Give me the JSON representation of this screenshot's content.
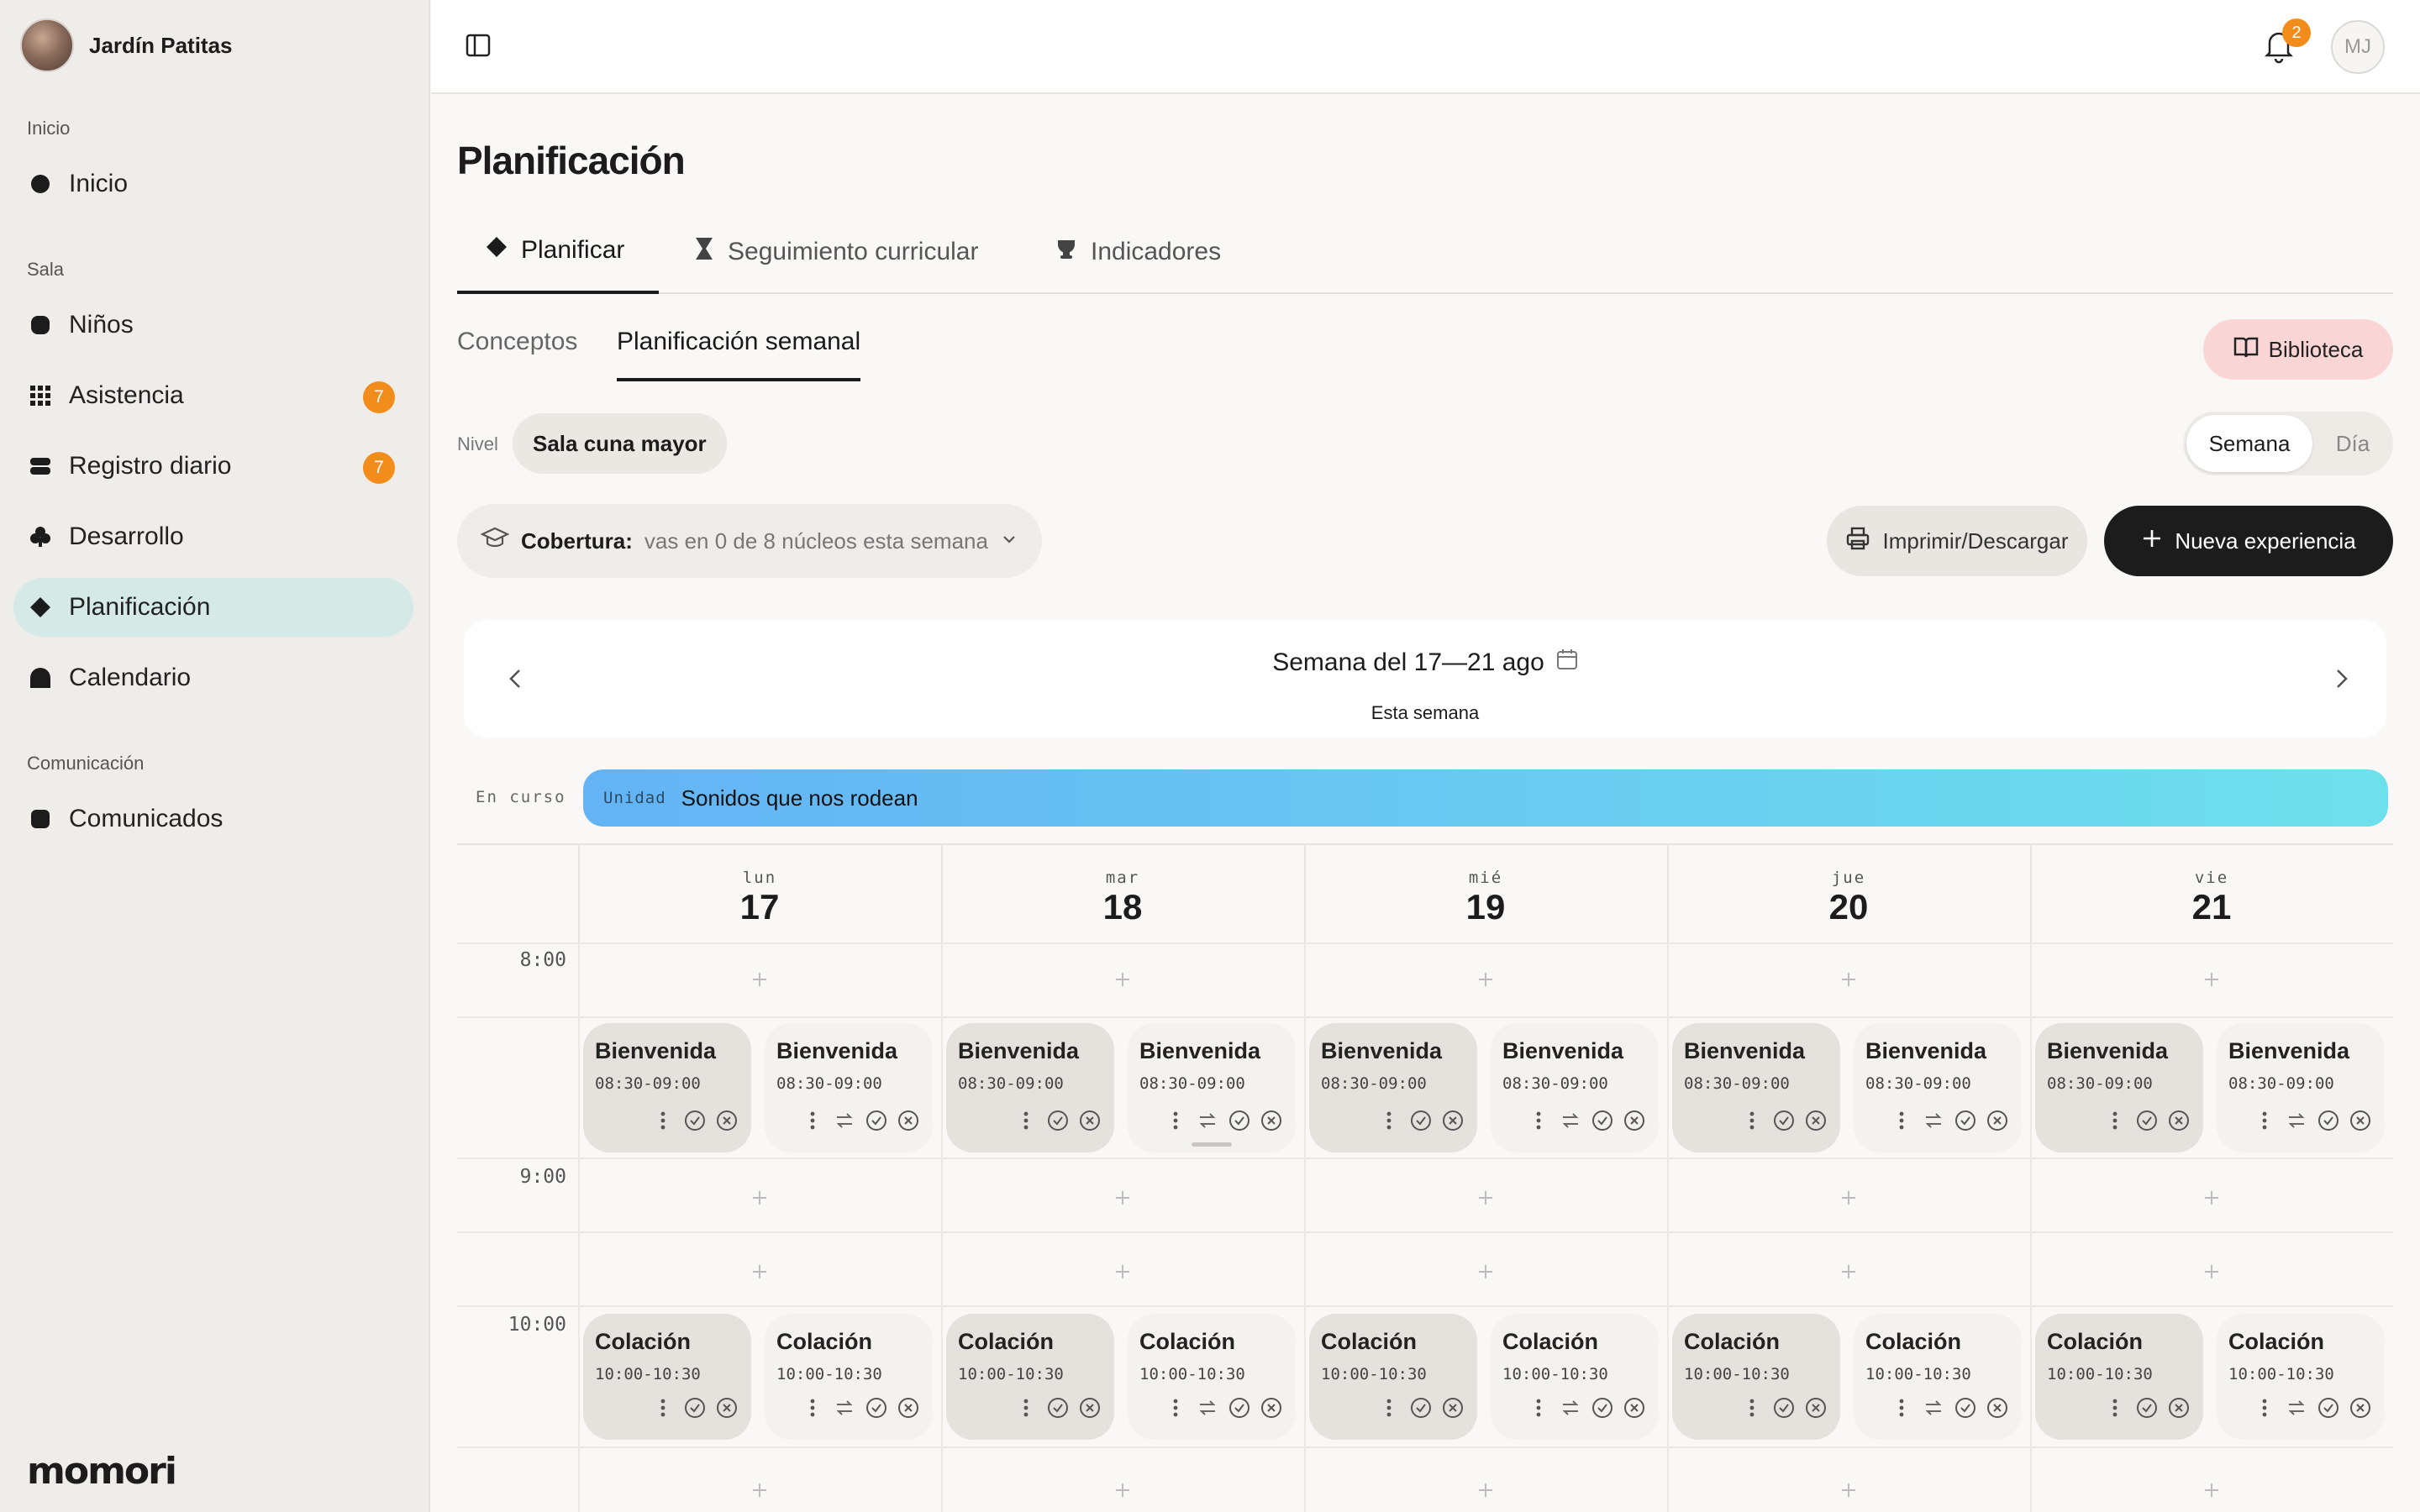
{
  "sidebar": {
    "org_name": "Jardín Patitas",
    "sections": {
      "inicio": "Inicio",
      "sala": "Sala",
      "comunicacion": "Comunicación"
    },
    "items": [
      {
        "label": "Inicio"
      },
      {
        "label": "Niños"
      },
      {
        "label": "Asistencia",
        "badge": "7"
      },
      {
        "label": "Registro diario",
        "badge": "7"
      },
      {
        "label": "Desarrollo"
      },
      {
        "label": "Planificación"
      },
      {
        "label": "Calendario"
      },
      {
        "label": "Comunicados"
      }
    ],
    "brand": "momori"
  },
  "topbar": {
    "notifications": "2",
    "user_initials": "MJ"
  },
  "page": {
    "title": "Planificación"
  },
  "tabs": [
    {
      "label": "Planificar"
    },
    {
      "label": "Seguimiento curricular"
    },
    {
      "label": "Indicadores"
    }
  ],
  "subtabs": [
    {
      "label": "Conceptos"
    },
    {
      "label": "Planificación semanal"
    }
  ],
  "biblioteca_label": "Biblioteca",
  "nivel": {
    "label": "Nivel",
    "value": "Sala cuna mayor"
  },
  "view_toggle": {
    "week": "Semana",
    "day": "Día"
  },
  "cobertura": {
    "label": "Cobertura:",
    "text": "vas en 0 de 8 núcleos esta semana"
  },
  "actions": {
    "print": "Imprimir/Descargar",
    "new": "Nueva experiencia"
  },
  "week": {
    "title": "Semana del 17—21 ago",
    "subtitle": "Esta semana"
  },
  "unit": {
    "status": "En curso",
    "label": "Unidad",
    "name": "Sonidos que nos rodean"
  },
  "days": [
    {
      "name": "lun",
      "num": "17"
    },
    {
      "name": "mar",
      "num": "18"
    },
    {
      "name": "mié",
      "num": "19"
    },
    {
      "name": "jue",
      "num": "20"
    },
    {
      "name": "vie",
      "num": "21"
    }
  ],
  "times": [
    "8:00",
    "9:00",
    "10:00"
  ],
  "events": {
    "bienvenida": {
      "title": "Bienvenida",
      "time": "08:30-09:00"
    },
    "colacion": {
      "title": "Colación",
      "time": "10:00-10:30"
    }
  },
  "colors": {
    "accent_active": "#d5e9e6",
    "badge": "#f28c1b",
    "biblioteca": "#f9d6d5",
    "primary": "#1c1c1c"
  }
}
